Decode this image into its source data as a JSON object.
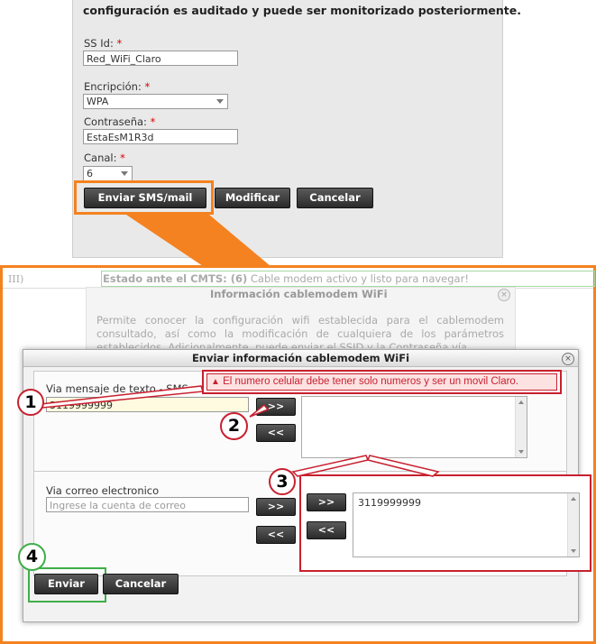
{
  "form": {
    "notice": "configuración es auditado y puede ser monitorizado posteriormente.",
    "ssid_label": "SS Id:",
    "ssid_value": "Red_WiFi_Claro",
    "encryption_label": "Encripción:",
    "encryption_value": "WPA",
    "password_label": "Contraseña:",
    "password_value": "EstaEsM1R3d",
    "channel_label": "Canal:",
    "channel_value": "6",
    "required_mark": "*",
    "send_button": "Enviar SMS/mail",
    "modify_button": "Modificar",
    "cancel_button": "Cancelar"
  },
  "background": {
    "row_prefix": "III)",
    "cmts_label": "Estado ante el CMTS: (6)",
    "cmts_value": "Cable modem activo y listo para navegar!",
    "info_title": "Información cablemodem WiFi",
    "info_text": "Permite conocer la configuración wifi establecida para el cablemodem consultado, así como la modificación de cualquiera de los parámetros establecidos. Adicionalmente, puede enviar el SSID y la Contraseña vía"
  },
  "dialog": {
    "title": "Enviar información cablemodem WiFi",
    "close_glyph": "×",
    "sms_label": "Via mensaje de texto - SMS",
    "sms_value": "3119999999",
    "error_message": "El numero celular debe tener solo numeros y ser un movil Claro.",
    "warning_glyph": "▲",
    "add_button": ">>",
    "remove_button": "<<",
    "email_label": "Via correo electronico",
    "email_placeholder": "Ingrese la cuenta de correo",
    "recipients": [
      "3119999999"
    ],
    "send_button": "Enviar",
    "cancel_button": "Cancelar"
  },
  "callouts": [
    "1",
    "2",
    "3",
    "4"
  ],
  "colors": {
    "orange_highlight": "#f58220",
    "red_annotation": "#c8202f",
    "green_annotation": "#3fae49",
    "error_text": "#c8202f"
  }
}
